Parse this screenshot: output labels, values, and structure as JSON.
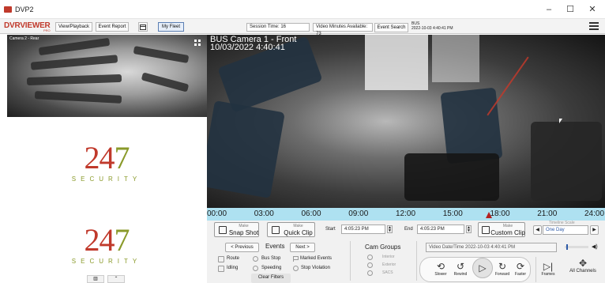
{
  "window": {
    "title": "DVP2",
    "controls": {
      "minimize": "–",
      "maximize": "☐",
      "close": "✕"
    }
  },
  "toolbar": {
    "logo": "DVRVIEWER",
    "logo_sub": "PRO",
    "buttons": [
      "View/Playback",
      "Event Report"
    ],
    "calendar_icon": "calendar-icon",
    "my_fleet": "My Fleet",
    "session_time": "Session Time: 16",
    "video_minutes": "Video Minutes Available: 73",
    "event_search": "Event Search",
    "bus_line1": "BUS",
    "bus_line2": "2022-10-03 4:40:41 PM",
    "menu_icon": "hamburger-menu-icon"
  },
  "small_camera": {
    "label": "Camera 2 - Rear"
  },
  "main_camera": {
    "label_line1": "BUS      Camera 1 - Front",
    "label_line2": "10/03/2022  4:40:41"
  },
  "brand": {
    "number_red": "24",
    "number_green": "7",
    "word": "SECURITY"
  },
  "timeline": {
    "ticks": [
      "00:00",
      "03:00",
      "06:00",
      "09:00",
      "12:00",
      "15:00",
      "18:00",
      "21:00",
      "24:00"
    ],
    "marker_hour": 17.3
  },
  "controls": {
    "snapshot_small": "Make",
    "snapshot_big": "Snap Shot",
    "quickclip_small": "Make",
    "quickclip_big": "Quick Clip",
    "start_label": "Start",
    "start_value": "4:05:23 PM",
    "end_label": "End",
    "end_value": "4:05:23 PM",
    "customclip_small": "Make",
    "customclip_big": "Custom Clip",
    "timeline_scale_label": "Timeline Scale",
    "timeline_scale_value": "One Day",
    "events_title": "Events",
    "previous": "< Previous",
    "next": "Next >",
    "event_types": [
      "Route",
      "Bus Stop",
      "Marked Events",
      "Idling",
      "Speeding",
      "Stop Violation"
    ],
    "clear_filters": "Clear Filters",
    "cam_groups_title": "Cam Groups",
    "cam_groups": [
      "Interior",
      "Exterior",
      "SACS"
    ],
    "video_datetime": "Video Date/Time  2022-10-03 4:40:41 PM",
    "playback": [
      "Slower",
      "Rewind",
      "",
      "Forward",
      "Faster"
    ],
    "frames": "Frames",
    "all_channels": "All Channels",
    "volume_level": 0.05
  }
}
